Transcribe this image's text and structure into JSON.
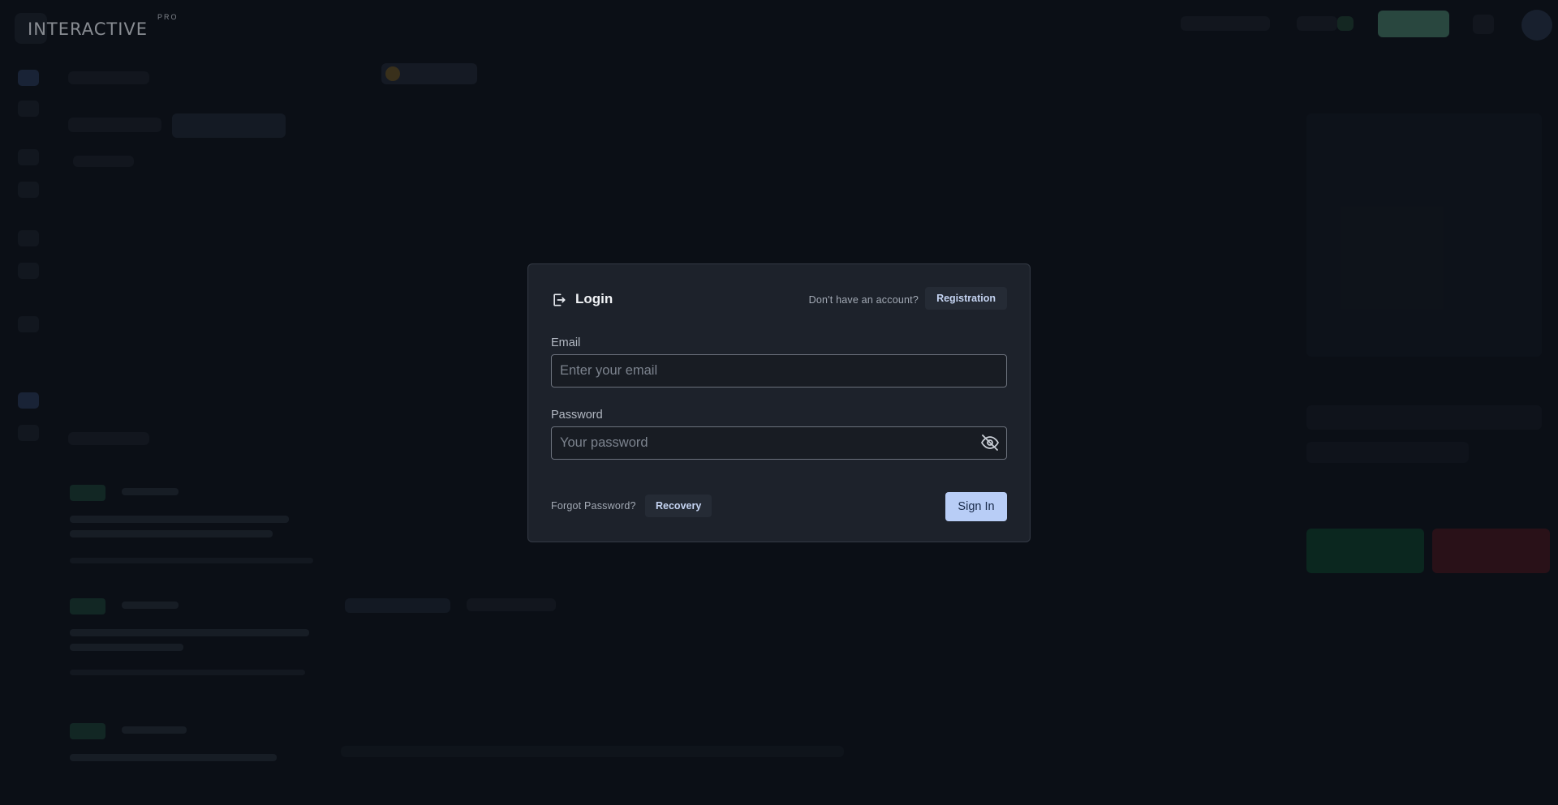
{
  "app": {
    "logo_text": "INTERACTIVE",
    "logo_badge": "PRO"
  },
  "login_modal": {
    "title": "Login",
    "title_icon": "login-arrow-icon",
    "no_account_text": "Don't have an account?",
    "registration_label": "Registration",
    "email": {
      "label": "Email",
      "placeholder": "Enter your email",
      "value": ""
    },
    "password": {
      "label": "Password",
      "placeholder": "Your password",
      "value": "",
      "visibility_icon": "eye-off-icon"
    },
    "forgot_text": "Forgot Password?",
    "recovery_label": "Recovery",
    "signin_label": "Sign In"
  },
  "colors": {
    "background": "#0f141c",
    "modal_background": "#1d222b",
    "primary_button": "#b8cdf6",
    "input_border": "#6b717c"
  }
}
